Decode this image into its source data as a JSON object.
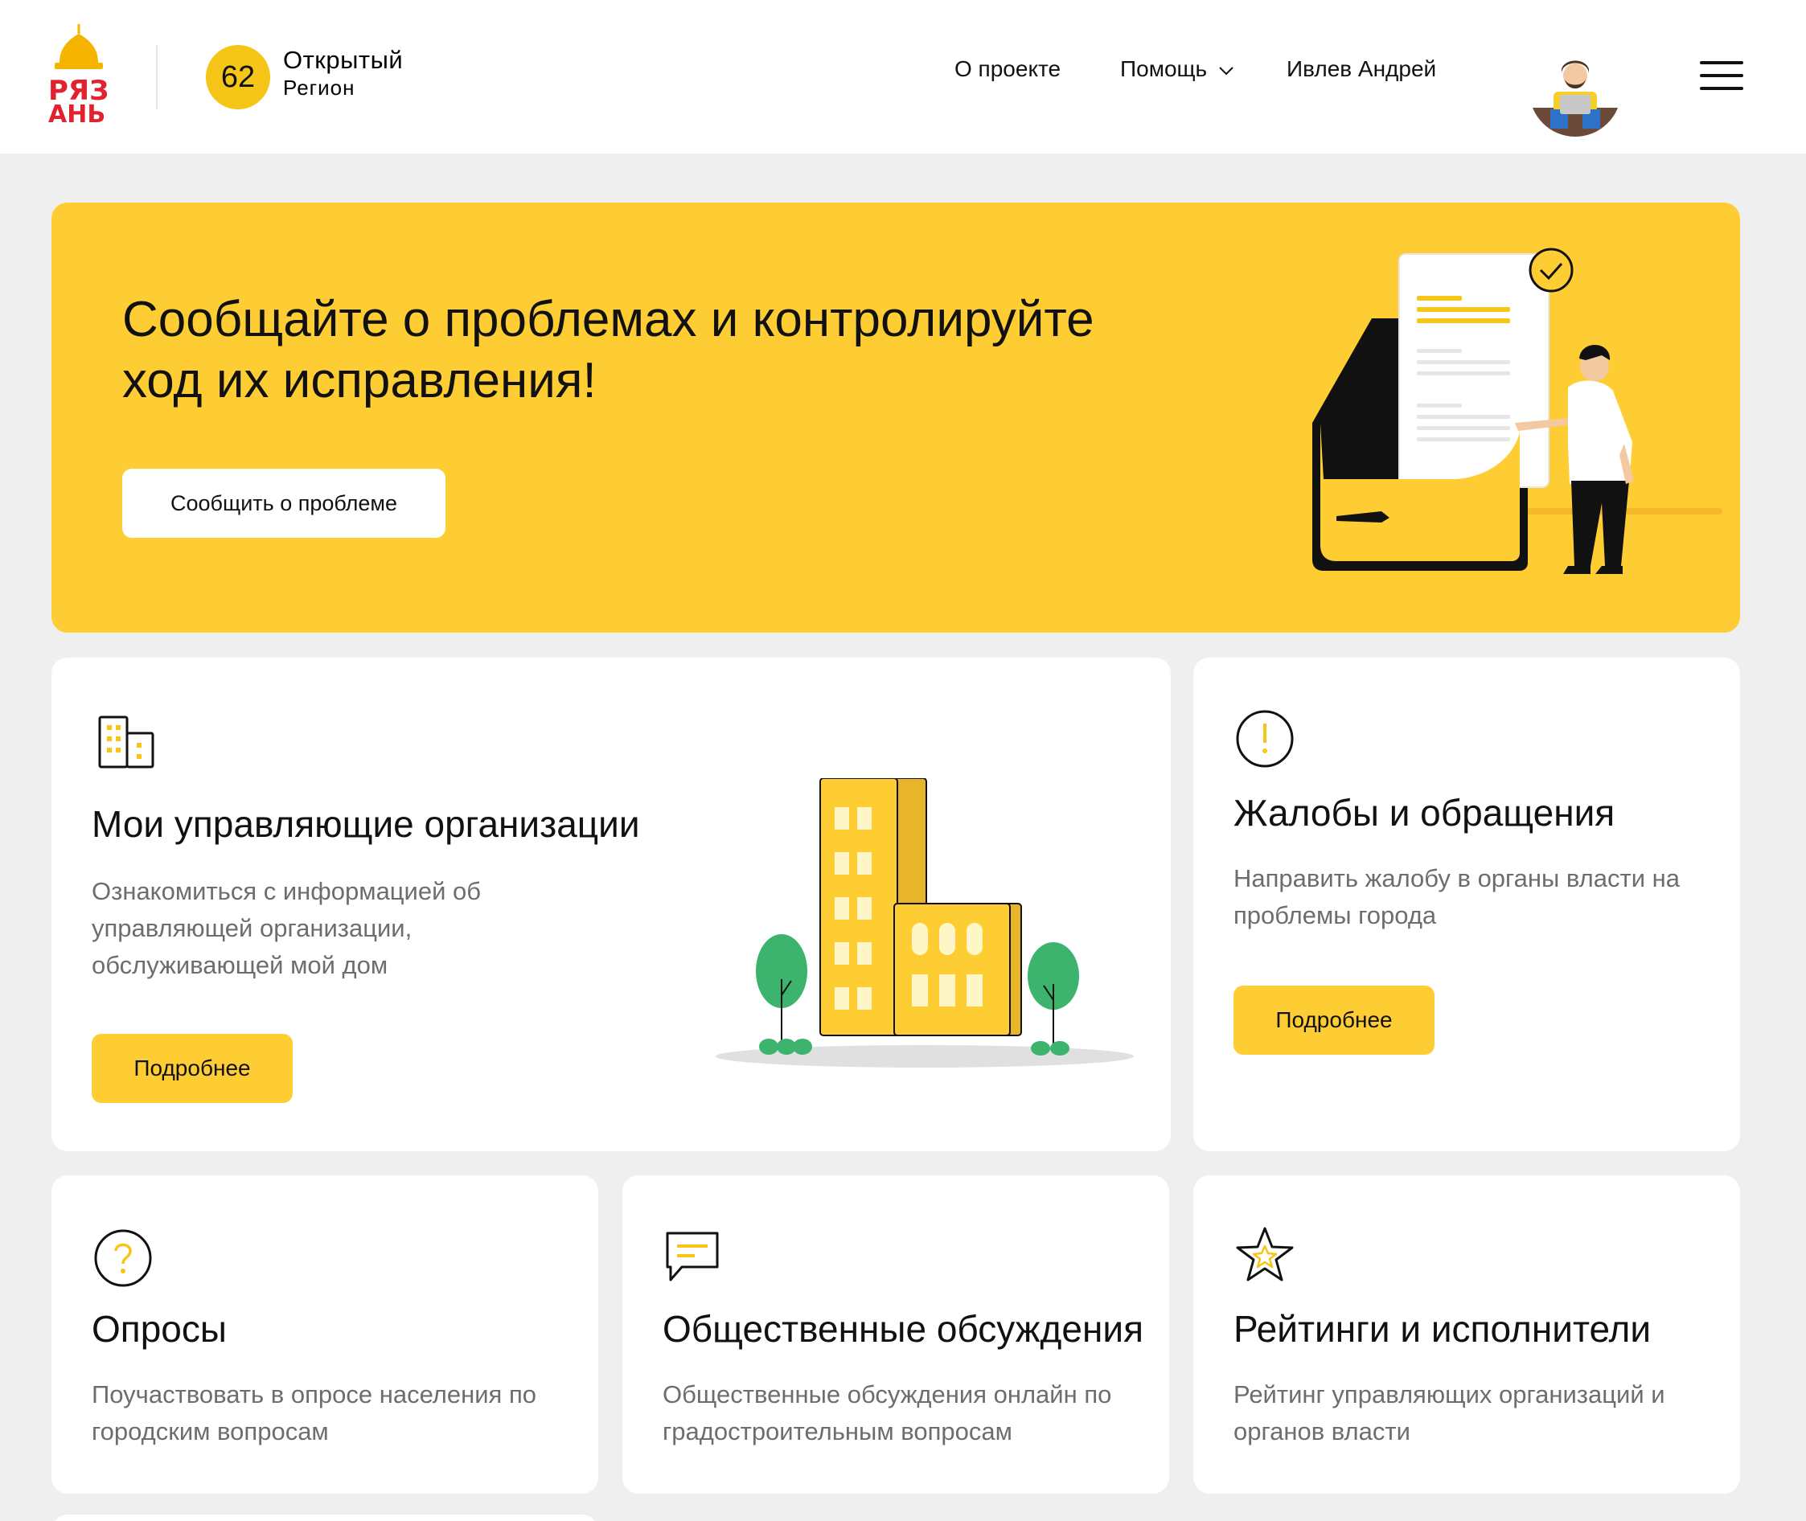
{
  "header": {
    "logo_text": "РЯЗАНЬ",
    "region_number": "62",
    "region_line1": "Открытый",
    "region_line2": "Регион",
    "nav": {
      "about": "О проекте",
      "help": "Помощь",
      "user": "Ивлев Андрей"
    },
    "icons": [
      "chevron-down-icon",
      "avatar",
      "menu-icon"
    ]
  },
  "hero": {
    "title": "Сообщайте о проблемах и контролируйте ход их исправления!",
    "button": "Сообщить о проблеме"
  },
  "cards": [
    {
      "icon": "building-icon",
      "title": "Мои управляющие организации",
      "description": "Ознакомиться с информацией об управляющей организации, обслуживающей мой дом",
      "button": "Подробнее"
    },
    {
      "icon": "alert-icon",
      "title": "Жалобы и обращения",
      "description": "Направить жалобу в органы власти на проблемы города",
      "button": "Подробнее"
    },
    {
      "icon": "question-icon",
      "title": "Опросы",
      "description": "Поучаствовать в опросе населения по городским вопросам"
    },
    {
      "icon": "chat-icon",
      "title": "Общественные обсуждения",
      "description": "Общественные обсуждения онлайн по градостроительным вопросам"
    },
    {
      "icon": "star-icon",
      "title": "Рейтинги и исполнители",
      "description": "Рейтинг управляющих организаций и органов власти"
    }
  ],
  "colors": {
    "accent": "#fecd34",
    "badge": "#f5c518",
    "background": "#efefef",
    "logo_red": "#e0232f",
    "tree_green": "#3cb46e"
  }
}
